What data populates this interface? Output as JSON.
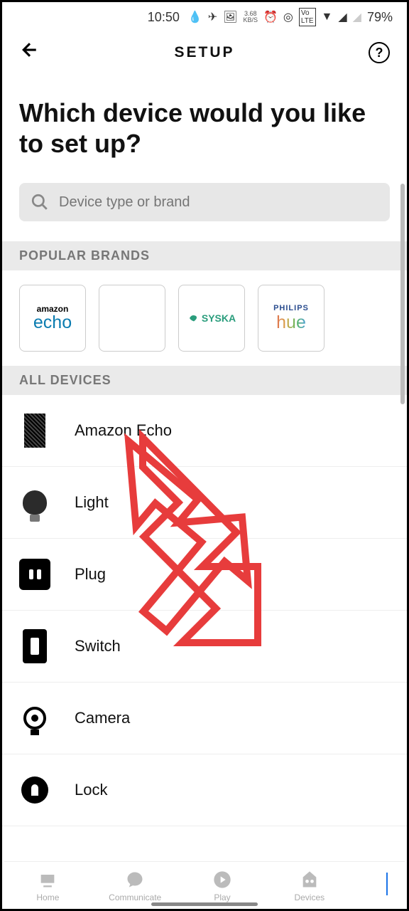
{
  "status": {
    "time": "10:50",
    "data": "3.68",
    "data_unit": "KB/S",
    "battery": "79%"
  },
  "header": {
    "title": "SETUP"
  },
  "question": "Which device would you like to set up?",
  "search": {
    "placeholder": "Device type or brand"
  },
  "sections": {
    "popular": "POPULAR BRANDS",
    "all": "ALL DEVICES"
  },
  "brands": [
    {
      "top": "amazon",
      "bottom": "echo"
    },
    {
      "top": "",
      "bottom": ""
    },
    {
      "top": "",
      "bottom": "SYSKA"
    },
    {
      "top": "PHILIPS",
      "bottom": "hue"
    }
  ],
  "devices": [
    {
      "label": "Amazon Echo"
    },
    {
      "label": "Light"
    },
    {
      "label": "Plug"
    },
    {
      "label": "Switch"
    },
    {
      "label": "Camera"
    },
    {
      "label": "Lock"
    }
  ],
  "nav": [
    {
      "label": "Home"
    },
    {
      "label": "Communicate"
    },
    {
      "label": "Play"
    },
    {
      "label": "Devices"
    }
  ]
}
